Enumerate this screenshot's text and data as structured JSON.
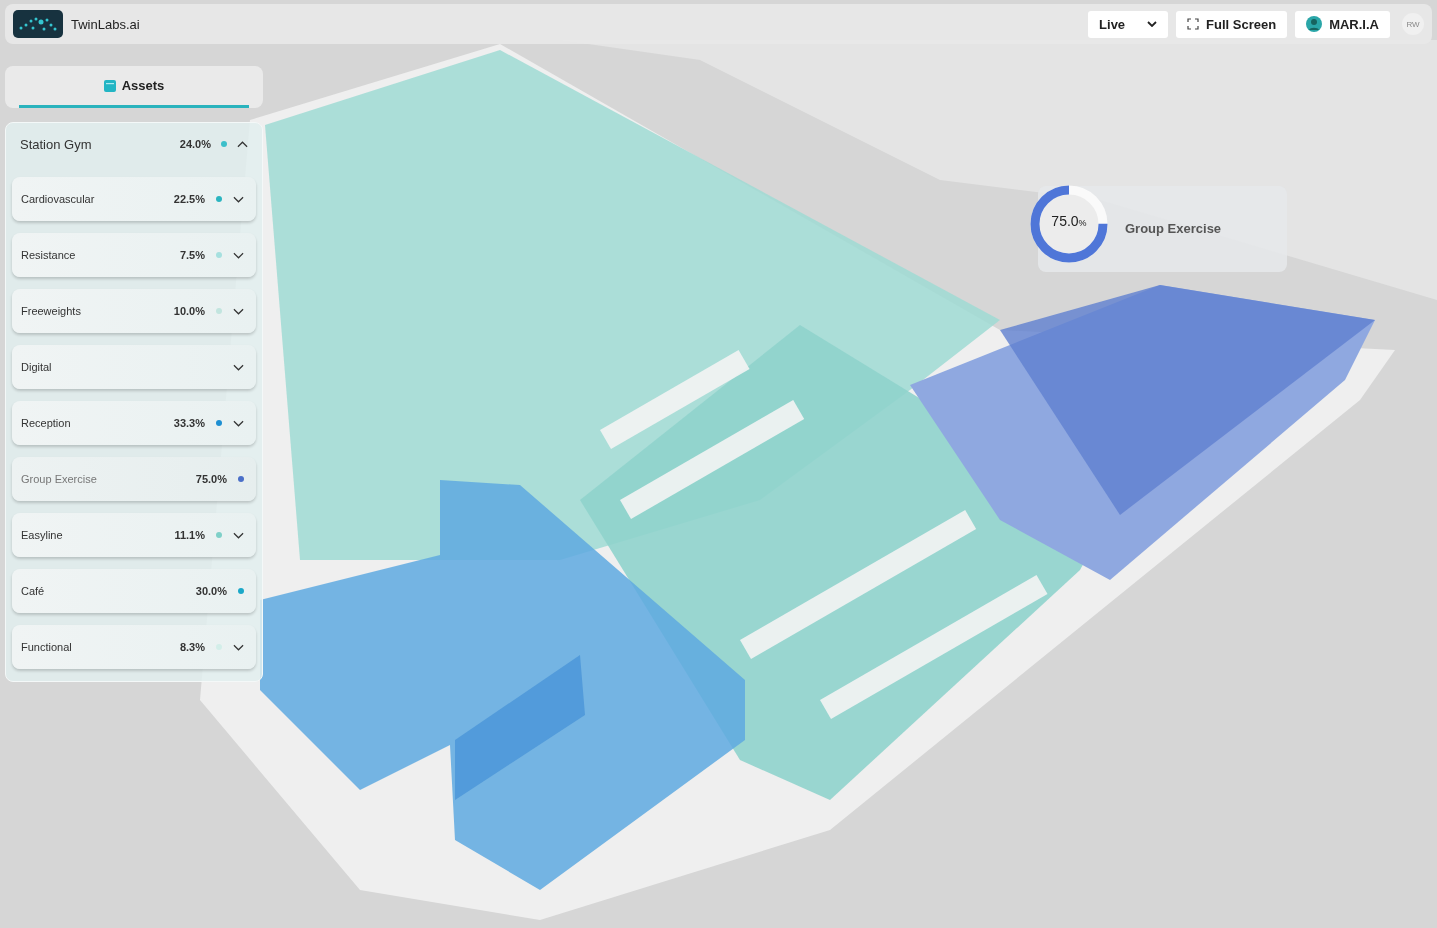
{
  "header": {
    "brand": "TwinLabs.ai",
    "mode": "Live",
    "fullscreen": "Full Screen",
    "user": "MAR.I.A",
    "initials": "RW"
  },
  "tabs": [
    {
      "label": "Assets",
      "selected": true
    }
  ],
  "site": {
    "name": "Station Gym",
    "value": "24.0%",
    "color": "#3cbfca",
    "expanded": true
  },
  "zones": [
    {
      "label": "Cardiovascular",
      "value": "22.5%",
      "color": "#2bb5c0",
      "expandable": true,
      "selected": false
    },
    {
      "label": "Resistance",
      "value": "7.5%",
      "color": "#a6e0df",
      "expandable": true,
      "selected": false
    },
    {
      "label": "Freeweights",
      "value": "10.0%",
      "color": "#c2e5df",
      "expandable": true,
      "selected": false
    },
    {
      "label": "Digital",
      "expandable": true,
      "selected": false
    },
    {
      "label": "Reception",
      "value": "33.3%",
      "color": "#1e8fd2",
      "expandable": true,
      "selected": false
    },
    {
      "label": "Group Exercise",
      "value": "75.0%",
      "color": "#4a6fc8",
      "expandable": false,
      "selected": true
    },
    {
      "label": "Easyline",
      "value": "11.1%",
      "color": "#7fd0c8",
      "expandable": true,
      "selected": false
    },
    {
      "label": "Café",
      "value": "30.0%",
      "color": "#1ba8c8",
      "expandable": false,
      "selected": false
    },
    {
      "label": "Functional",
      "value": "8.3%",
      "color": "#d3eee9",
      "expandable": true,
      "selected": false
    }
  ],
  "callout": {
    "value": "75.0",
    "unit": "%",
    "label": "Group Exercise",
    "level": 0.75
  }
}
